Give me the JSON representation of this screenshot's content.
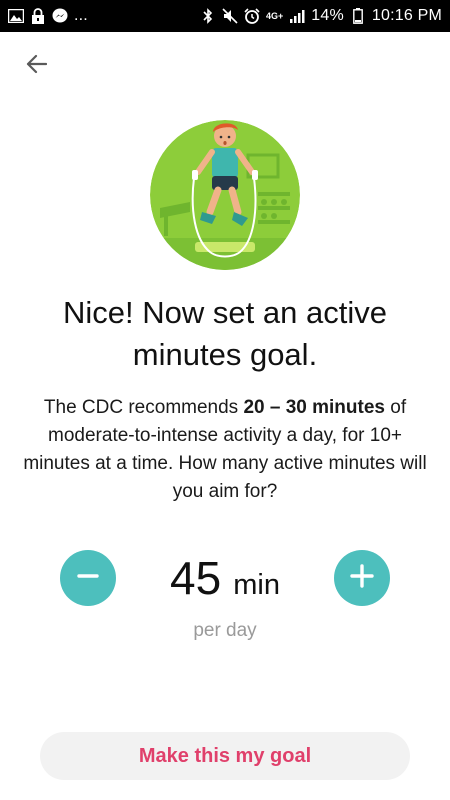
{
  "status_bar": {
    "left_icons": [
      "image-icon",
      "lock-icon",
      "messenger-icon"
    ],
    "overflow": "...",
    "right_icons": [
      "bluetooth-icon",
      "mute-icon",
      "alarm-icon"
    ],
    "network_label": "4G+",
    "battery": "14%",
    "time": "10:16 PM"
  },
  "nav": {
    "back_icon": "arrow-left-icon"
  },
  "hero": {
    "illustration": "person-jumping-rope-illustration",
    "colors": {
      "circle": "#8dcd3a",
      "accent": "#6fb52e"
    }
  },
  "content": {
    "headline": "Nice! Now set an active minutes goal.",
    "description_prefix": "The CDC recommends ",
    "description_bold": "20 – 30 minutes",
    "description_suffix": " of moderate-to-intense activity a day, for 10+ minutes at a time. How many active minutes will you aim for?"
  },
  "goal": {
    "value": "45",
    "unit": "min",
    "period": "per day",
    "decrement_icon": "minus-icon",
    "increment_icon": "plus-icon",
    "accent_color": "#4dbfbd"
  },
  "cta": {
    "label": "Make this my goal",
    "color": "#e0406b"
  }
}
